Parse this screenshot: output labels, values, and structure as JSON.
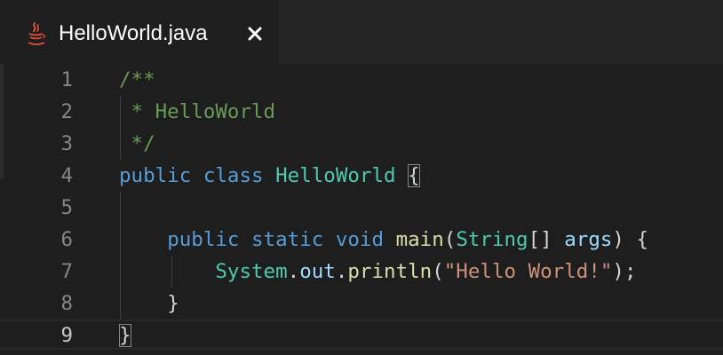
{
  "tab": {
    "title": "HelloWorld.java",
    "icon": "java-coffee-cup-icon",
    "close_icon": "close-icon",
    "icon_color": "#e34b3b"
  },
  "editor": {
    "active_line": 9,
    "lines": [
      {
        "number": "1",
        "tokens": [
          {
            "t": "/**",
            "c": "cm"
          }
        ]
      },
      {
        "number": "2",
        "tokens": [
          {
            "t": " * HelloWorld",
            "c": "cm"
          }
        ]
      },
      {
        "number": "3",
        "tokens": [
          {
            "t": " */",
            "c": "cm"
          }
        ]
      },
      {
        "number": "4",
        "tokens": [
          {
            "t": "public",
            "c": "kw"
          },
          {
            "t": " ",
            "c": "pn"
          },
          {
            "t": "class",
            "c": "kw"
          },
          {
            "t": " ",
            "c": "pn"
          },
          {
            "t": "HelloWorld",
            "c": "ty"
          },
          {
            "t": " ",
            "c": "pn"
          },
          {
            "t": "{",
            "c": "pn",
            "match": true
          }
        ]
      },
      {
        "number": "5",
        "tokens": []
      },
      {
        "number": "6",
        "tokens": [
          {
            "t": "    ",
            "c": "pn"
          },
          {
            "t": "public",
            "c": "kw"
          },
          {
            "t": " ",
            "c": "pn"
          },
          {
            "t": "static",
            "c": "kw"
          },
          {
            "t": " ",
            "c": "pn"
          },
          {
            "t": "void",
            "c": "kw"
          },
          {
            "t": " ",
            "c": "pn"
          },
          {
            "t": "main",
            "c": "fn"
          },
          {
            "t": "(",
            "c": "pn"
          },
          {
            "t": "String",
            "c": "ty"
          },
          {
            "t": "[] ",
            "c": "pn"
          },
          {
            "t": "args",
            "c": "vr"
          },
          {
            "t": ") {",
            "c": "pn"
          }
        ]
      },
      {
        "number": "7",
        "tokens": [
          {
            "t": "        ",
            "c": "pn"
          },
          {
            "t": "System",
            "c": "ty"
          },
          {
            "t": ".",
            "c": "pn"
          },
          {
            "t": "out",
            "c": "vr"
          },
          {
            "t": ".",
            "c": "pn"
          },
          {
            "t": "println",
            "c": "fn"
          },
          {
            "t": "(",
            "c": "pn"
          },
          {
            "t": "\"Hello World!\"",
            "c": "str"
          },
          {
            "t": ");",
            "c": "pn"
          }
        ]
      },
      {
        "number": "8",
        "tokens": [
          {
            "t": "    ",
            "c": "pn"
          },
          {
            "t": "}",
            "c": "pn"
          }
        ]
      },
      {
        "number": "9",
        "tokens": [
          {
            "t": "}",
            "c": "pn",
            "match": true
          }
        ]
      }
    ]
  }
}
